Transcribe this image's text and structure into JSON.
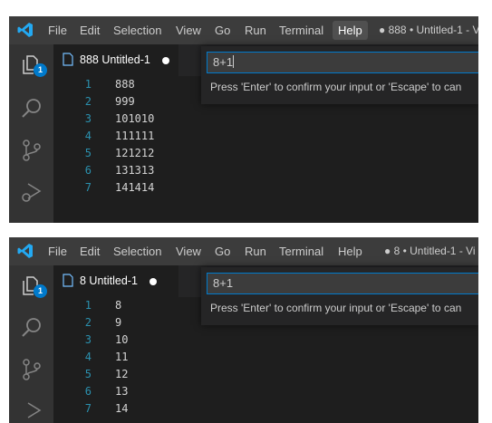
{
  "menu": [
    "File",
    "Edit",
    "Selection",
    "View",
    "Go",
    "Run",
    "Terminal",
    "Help"
  ],
  "colors": {
    "titlebar": "#3c3c3c",
    "activity_bar": "#333333",
    "editor_bg": "#1e1e1e",
    "line_number": "#2b91af",
    "accent": "#007acc",
    "logo": "#23a9f2"
  },
  "icons": [
    "vscode-logo-icon",
    "explorer-icon",
    "search-icon",
    "source-control-icon",
    "run-debug-icon",
    "file-icon"
  ],
  "panels": [
    {
      "window_title": "● 888 • Untitled-1 - V",
      "active_menu": "Help",
      "explorer_badge": "1",
      "tab": {
        "title": "888 Untitled-1"
      },
      "quick_input": {
        "value": "8+1",
        "message": "Press 'Enter' to confirm your input or 'Escape' to can"
      },
      "lines": [
        {
          "number": "1",
          "text": "888"
        },
        {
          "number": "2",
          "text": "999"
        },
        {
          "number": "3",
          "text": "101010"
        },
        {
          "number": "4",
          "text": "111111"
        },
        {
          "number": "5",
          "text": "121212"
        },
        {
          "number": "6",
          "text": "131313"
        },
        {
          "number": "7",
          "text": "141414"
        }
      ]
    },
    {
      "window_title": "● 8 • Untitled-1 - Vi",
      "active_menu": "",
      "explorer_badge": "1",
      "tab": {
        "title": "8 Untitled-1"
      },
      "quick_input": {
        "value": "8+1",
        "message": "Press 'Enter' to confirm your input or 'Escape' to can"
      },
      "lines": [
        {
          "number": "1",
          "text": "8"
        },
        {
          "number": "2",
          "text": "9"
        },
        {
          "number": "3",
          "text": "10"
        },
        {
          "number": "4",
          "text": "11"
        },
        {
          "number": "5",
          "text": "12"
        },
        {
          "number": "6",
          "text": "13"
        },
        {
          "number": "7",
          "text": "14"
        }
      ]
    }
  ]
}
